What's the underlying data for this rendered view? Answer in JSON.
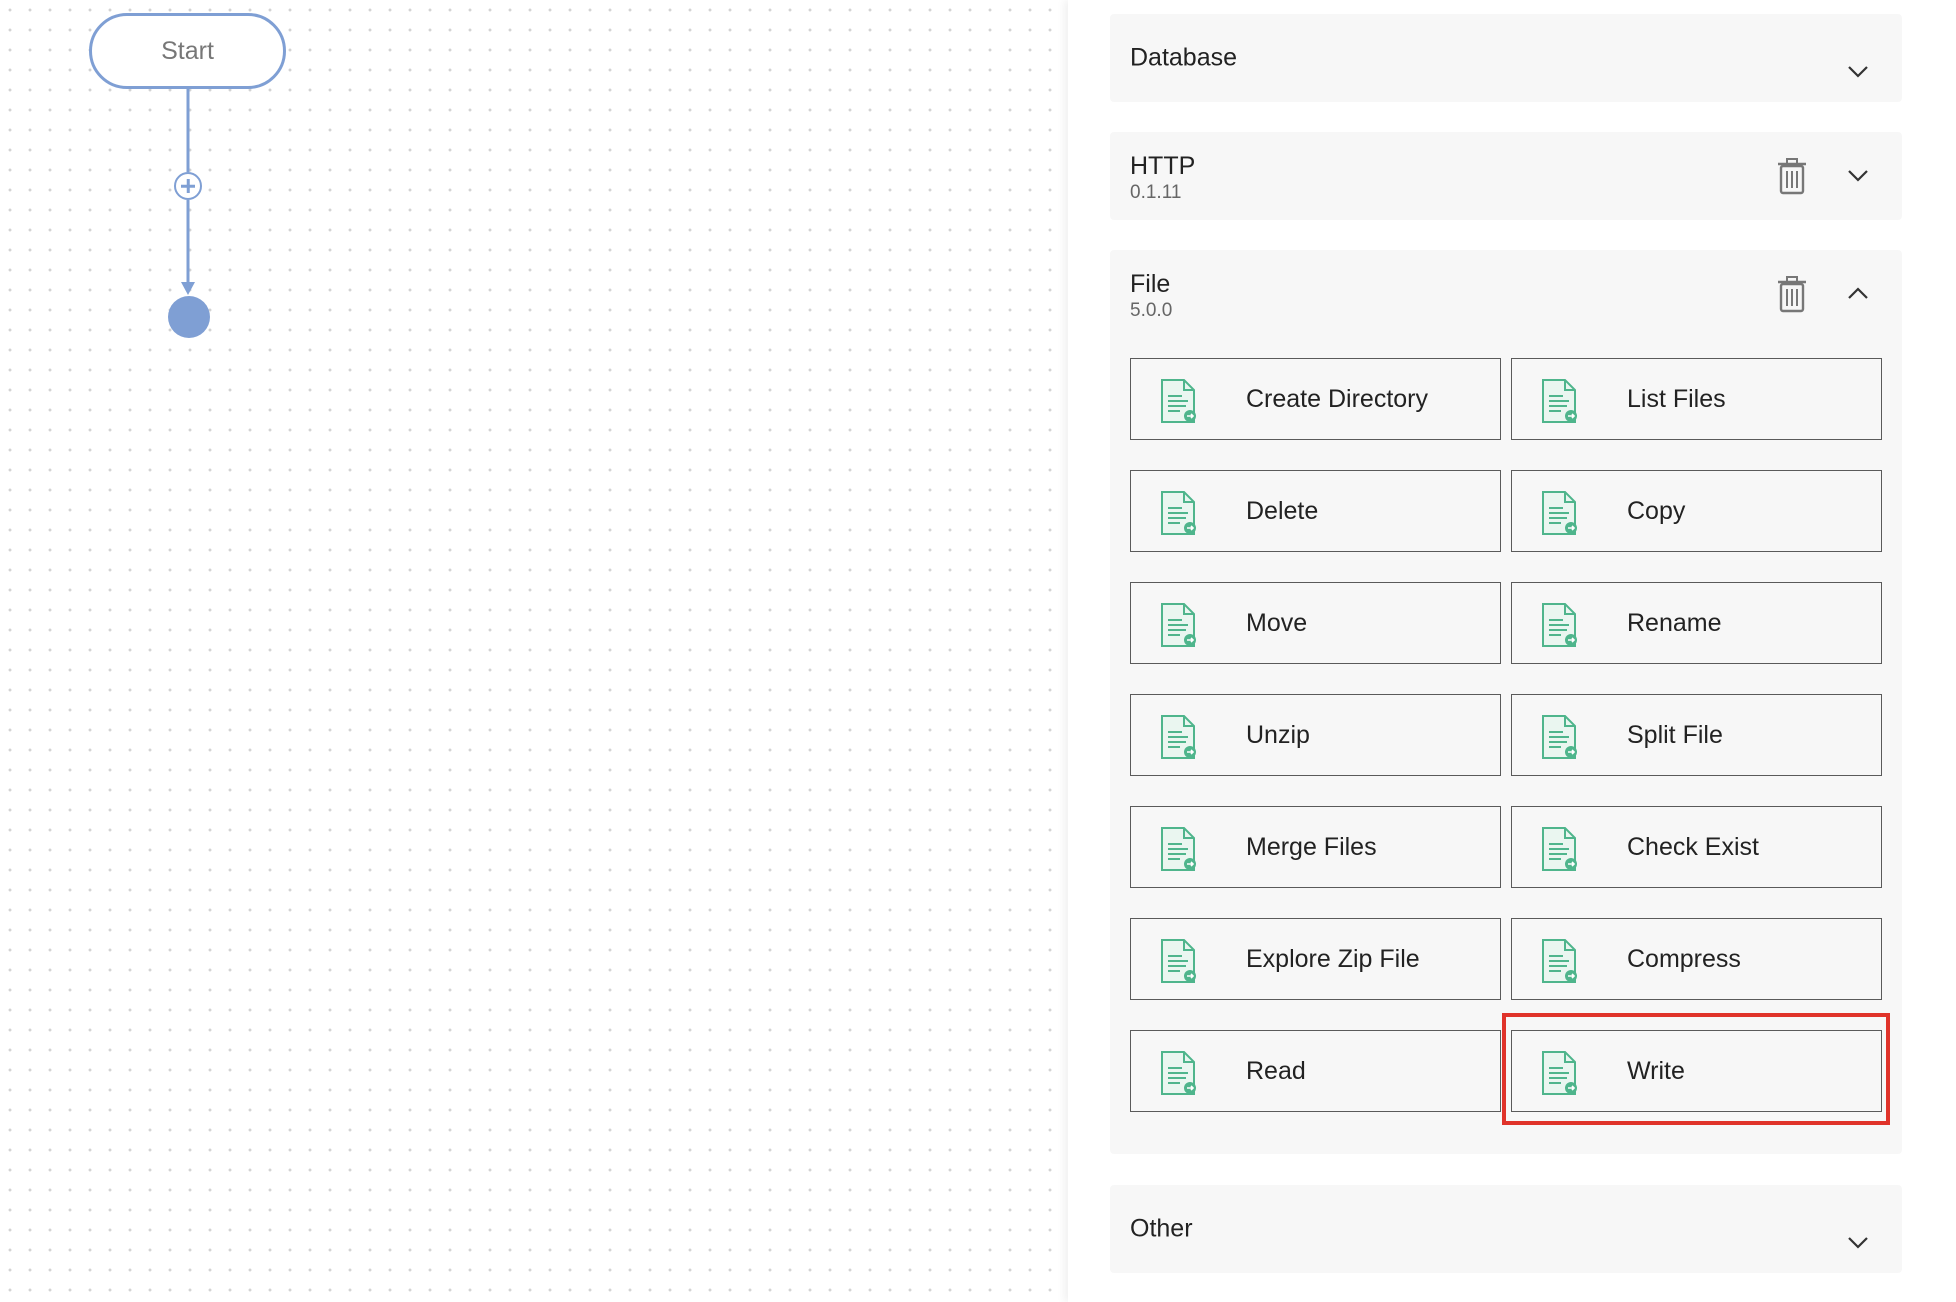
{
  "flow": {
    "start_label": "Start"
  },
  "panel": {
    "sections": {
      "database": {
        "title": "Database",
        "expanded": false
      },
      "http": {
        "title": "HTTP",
        "version": "0.1.11",
        "expanded": false
      },
      "file": {
        "title": "File",
        "version": "5.0.0",
        "expanded": true,
        "actions": [
          "Create Directory",
          "List Files",
          "Delete",
          "Copy",
          "Move",
          "Rename",
          "Unzip",
          "Split File",
          "Merge Files",
          "Check Exist",
          "Explore Zip File",
          "Compress",
          "Read",
          "Write"
        ]
      },
      "other": {
        "title": "Other",
        "expanded": false
      }
    }
  },
  "colors": {
    "flow_accent": "#7f9fd4",
    "file_icon_green": "#4fb58c",
    "highlight_red": "#e0332a"
  },
  "icons": {
    "chevron_collapsed": "chevron-down-icon",
    "chevron_expanded": "chevron-up-icon",
    "delete": "trash-icon",
    "action": "file-document-icon"
  },
  "highlighted_action": "Write"
}
